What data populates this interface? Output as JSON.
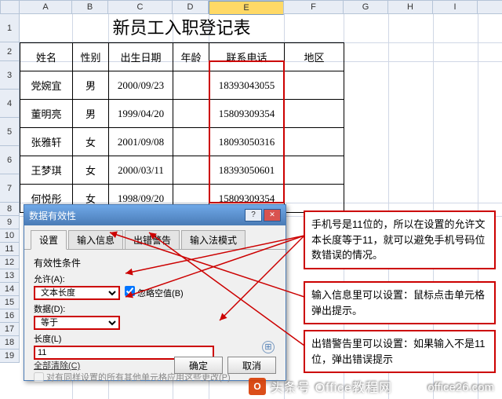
{
  "columns": [
    "A",
    "B",
    "C",
    "D",
    "E",
    "F",
    "G",
    "H",
    "I"
  ],
  "title": "新员工入职登记表",
  "headers": {
    "name": "姓名",
    "gender": "性别",
    "dob": "出生日期",
    "age": "年龄",
    "phone": "联系电话",
    "region": "地区"
  },
  "rows": [
    {
      "name": "党婉宜",
      "gender": "男",
      "dob": "2000/09/23",
      "age": "",
      "phone": "18393043055",
      "region": ""
    },
    {
      "name": "董明亮",
      "gender": "男",
      "dob": "1999/04/20",
      "age": "",
      "phone": "15809309354",
      "region": ""
    },
    {
      "name": "张雅轩",
      "gender": "女",
      "dob": "2001/09/08",
      "age": "",
      "phone": "18093050316",
      "region": ""
    },
    {
      "name": "王梦琪",
      "gender": "女",
      "dob": "2000/03/11",
      "age": "",
      "phone": "18393050601",
      "region": ""
    },
    {
      "name": "何悦彤",
      "gender": "女",
      "dob": "1998/09/20",
      "age": "",
      "phone": "15809309354",
      "region": ""
    }
  ],
  "dialog": {
    "title": "数据有效性",
    "tabs": {
      "settings": "设置",
      "input": "输入信息",
      "error": "出错警告",
      "ime": "输入法模式"
    },
    "group": "有效性条件",
    "allow_label": "允许(A):",
    "allow_value": "文本长度",
    "ignore_blank": "忽略空值(B)",
    "data_label": "数据(D):",
    "data_value": "等于",
    "length_label": "长度(L)",
    "length_value": "11",
    "apply_same": "对有同样设置的所有其他单元格应用这些更改(P)",
    "clear_all": "全部清除(C)",
    "ok": "确定",
    "cancel": "取消"
  },
  "annotations": {
    "a1": "手机号是11位的，所以在设置的允许文本长度等于11，就可以避免手机号码位数错误的情况。",
    "a2": "输入信息里可以设置：鼠标点击单元格弹出提示。",
    "a3": "出错警告里可以设置：如果输入不是11位，弹出错误提示"
  },
  "watermark": {
    "src": "头条号",
    "name": "Office教程网",
    "site": "office26.com"
  }
}
